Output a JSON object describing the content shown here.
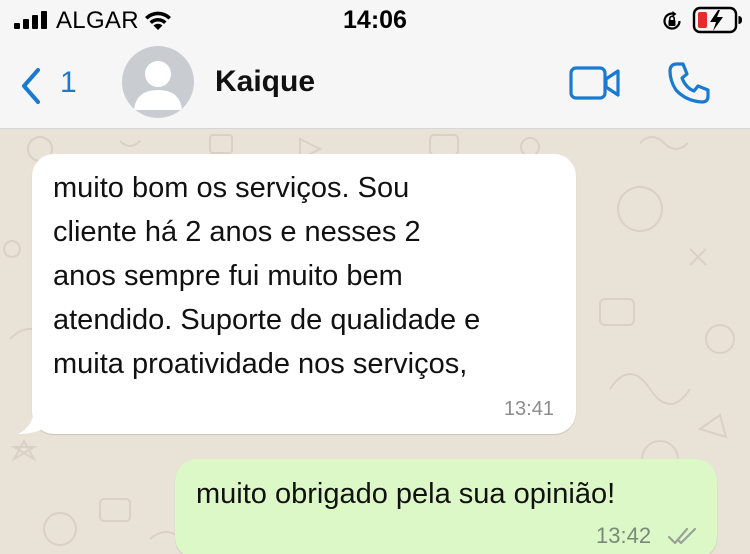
{
  "status_bar": {
    "carrier": "ALGAR",
    "time": "14:06",
    "icons": [
      "signal-icon",
      "wifi-icon",
      "rotation-lock-icon",
      "battery-charging-icon"
    ]
  },
  "header": {
    "back_count": "1",
    "contact_name": "Kaique",
    "icons": [
      "back-chevron-icon",
      "video-call-icon",
      "voice-call-icon"
    ]
  },
  "messages": [
    {
      "direction": "incoming",
      "lines": [
        "muito bom os serviços. Sou",
        "cliente há 2 anos e nesses 2",
        "anos sempre fui muito bem",
        "atendido. Suporte de qualidade e",
        "muita proatividade nos serviços,"
      ],
      "time": "13:41"
    },
    {
      "direction": "outgoing",
      "text": "muito obrigado pela sua opinião!",
      "time": "13:42",
      "status": "read"
    }
  ],
  "colors": {
    "accent": "#1a7ad1",
    "chat_background": "#e9e2d6",
    "incoming_bubble": "#ffffff",
    "outgoing_bubble": "#dcf8c6",
    "read_ticks": "#9aa09a"
  }
}
